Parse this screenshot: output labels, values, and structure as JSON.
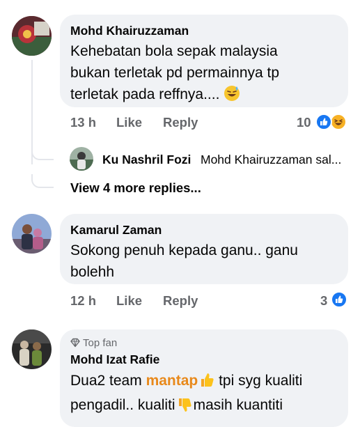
{
  "comments": [
    {
      "author": "Mohd Khairuzzaman",
      "text": "Kehebatan bola sepak malaysia bukan terletak pd permainnya tp terletak pada reffnya....",
      "text_emoji": "sweat-smile-emoji",
      "time": "13 h",
      "like": "Like",
      "reply": "Reply",
      "reaction_count": "10",
      "reactions": [
        "like-reaction-icon",
        "haha-reaction-icon"
      ]
    },
    {
      "author": "Kamarul Zaman",
      "text": "Sokong penuh kepada ganu.. ganu bolehh",
      "time": "12 h",
      "like": "Like",
      "reply": "Reply",
      "reaction_count": "3",
      "reactions": [
        "like-reaction-icon"
      ]
    },
    {
      "badge": "Top fan",
      "author": "Mohd Izat Rafie",
      "text_part1": "Dua2 team ",
      "text_highlight": "mantap",
      "text_part2": " tpi syg kualiti",
      "text_line2_part1": "pengadil.. kualiti",
      "text_line2_part2": "masih kuantiti"
    }
  ],
  "reply_preview": {
    "author": "Ku Nashril Fozi",
    "text": "Mohd Khairuzzaman sal..."
  },
  "more_replies": "View 4 more replies...",
  "colors": {
    "bubble": "#f0f2f5",
    "meta_text": "#65676b",
    "like_blue": "#1877f2",
    "haha_yellow": "#f7b125",
    "highlight_orange": "#e8891b"
  }
}
